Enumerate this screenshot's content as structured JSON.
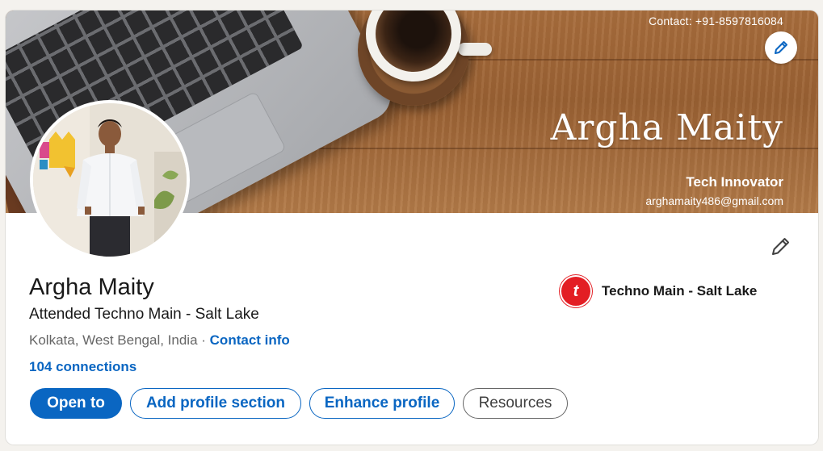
{
  "banner": {
    "contact": "Contact: +91-8597816084",
    "name": "Argha Maity",
    "title": "Tech Innovator",
    "email": "arghamaity486@gmail.com",
    "edit_icon": "pencil-icon"
  },
  "profile": {
    "name": "Argha Maity",
    "headline": "Attended Techno Main - Salt Lake",
    "location": "Kolkata, West Bengal, India",
    "separator": " · ",
    "contact_info": "Contact info",
    "connections": "104 connections",
    "edit_icon": "pencil-icon"
  },
  "education": {
    "school_name": "Techno Main - Salt Lake",
    "logo_letter": "t"
  },
  "actions": {
    "open_to": "Open to",
    "add_section": "Add profile section",
    "enhance": "Enhance profile",
    "resources": "Resources"
  },
  "colors": {
    "brand_blue": "#0a66c2",
    "school_red": "#e31e24"
  }
}
